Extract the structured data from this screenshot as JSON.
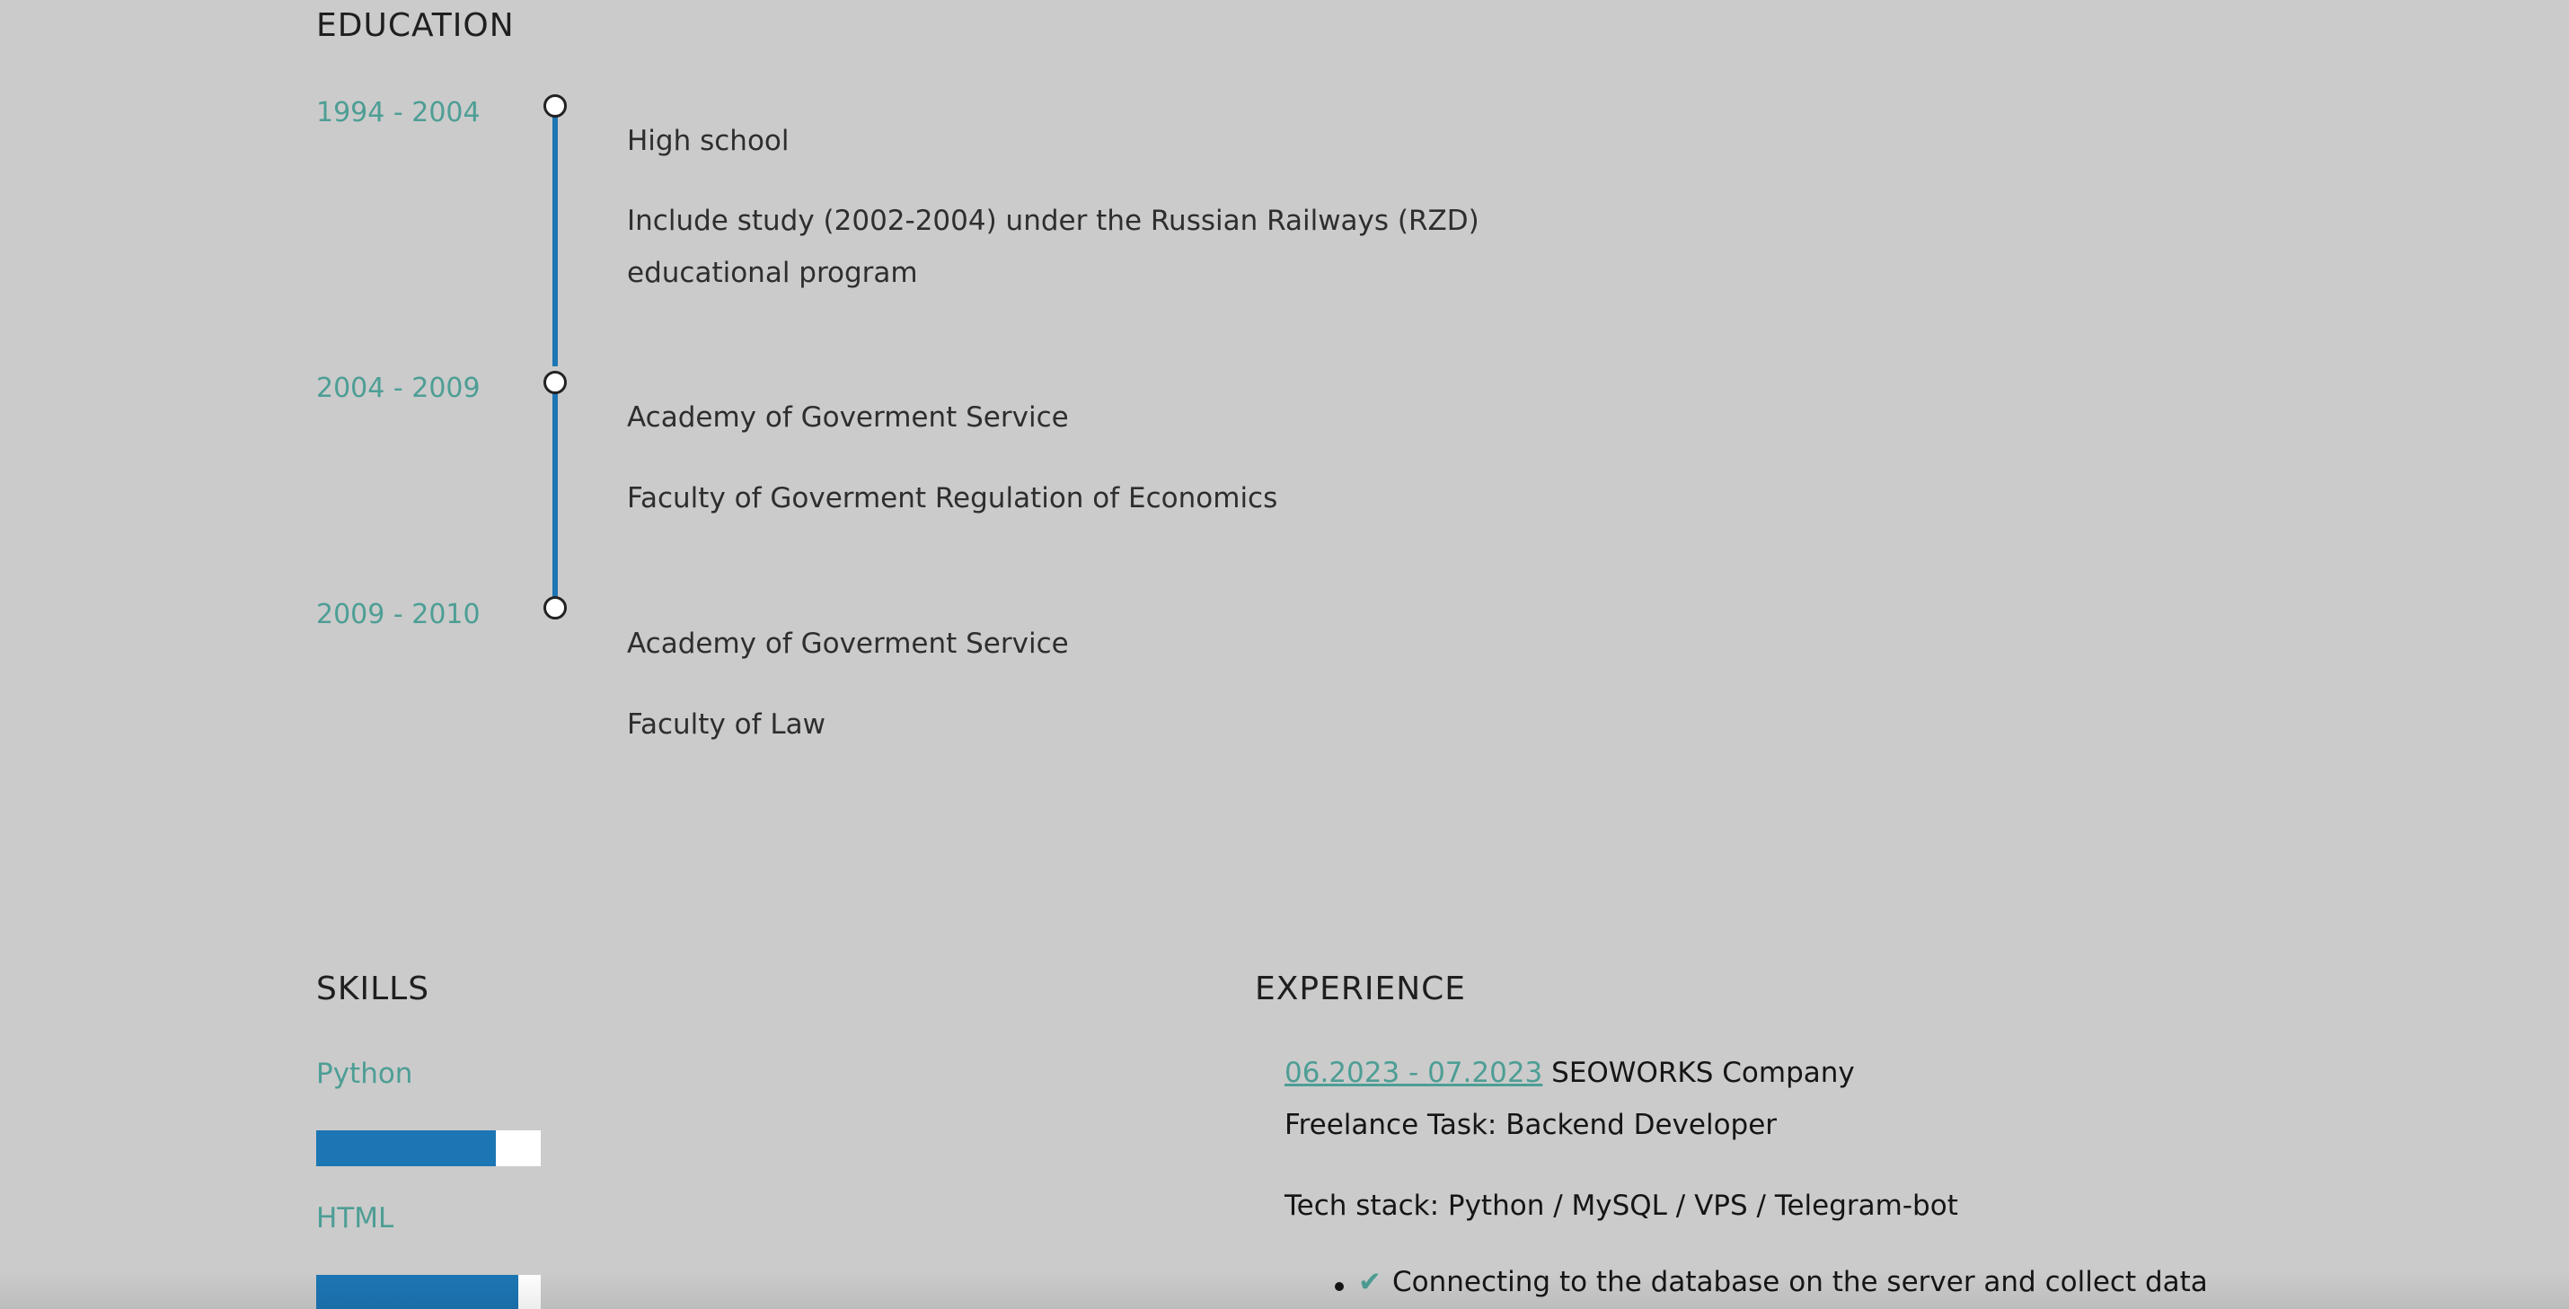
{
  "education": {
    "title": "EDUCATION",
    "entries": [
      {
        "period": "1994 - 2004",
        "lines": [
          "High school",
          "Include study (2002-2004) under the Russian Railways (RZD)",
          "educational program"
        ]
      },
      {
        "period": "2004 - 2009",
        "lines": [
          "Academy of Goverment Service",
          "Faculty of Goverment Regulation of Economics"
        ]
      },
      {
        "period": "2009 - 2010",
        "lines": [
          "Academy of Goverment Service",
          "Faculty of Law"
        ]
      }
    ]
  },
  "skills": {
    "title": "SKILLS",
    "items": [
      {
        "name": "Python",
        "level_percent": 80
      },
      {
        "name": "HTML",
        "level_percent": 90
      }
    ]
  },
  "experience": {
    "title": "EXPERIENCE",
    "items": [
      {
        "period_link": "06.2023 - 07.2023",
        "company": "SEOWORKS Company",
        "role": "Freelance Task: Backend Developer",
        "tech_stack": "Tech stack: Python / MySQL / VPS / Telegram-bot",
        "bullets": [
          "Connecting to the database on the server and collect data"
        ]
      }
    ]
  },
  "colors": {
    "background": "#cbcbcb",
    "accent_teal": "#4d9e95",
    "accent_blue": "#1c76b4"
  },
  "icons": {
    "timeline_marker": "circle-marker-icon",
    "bullet_check": "checkmark-icon"
  }
}
